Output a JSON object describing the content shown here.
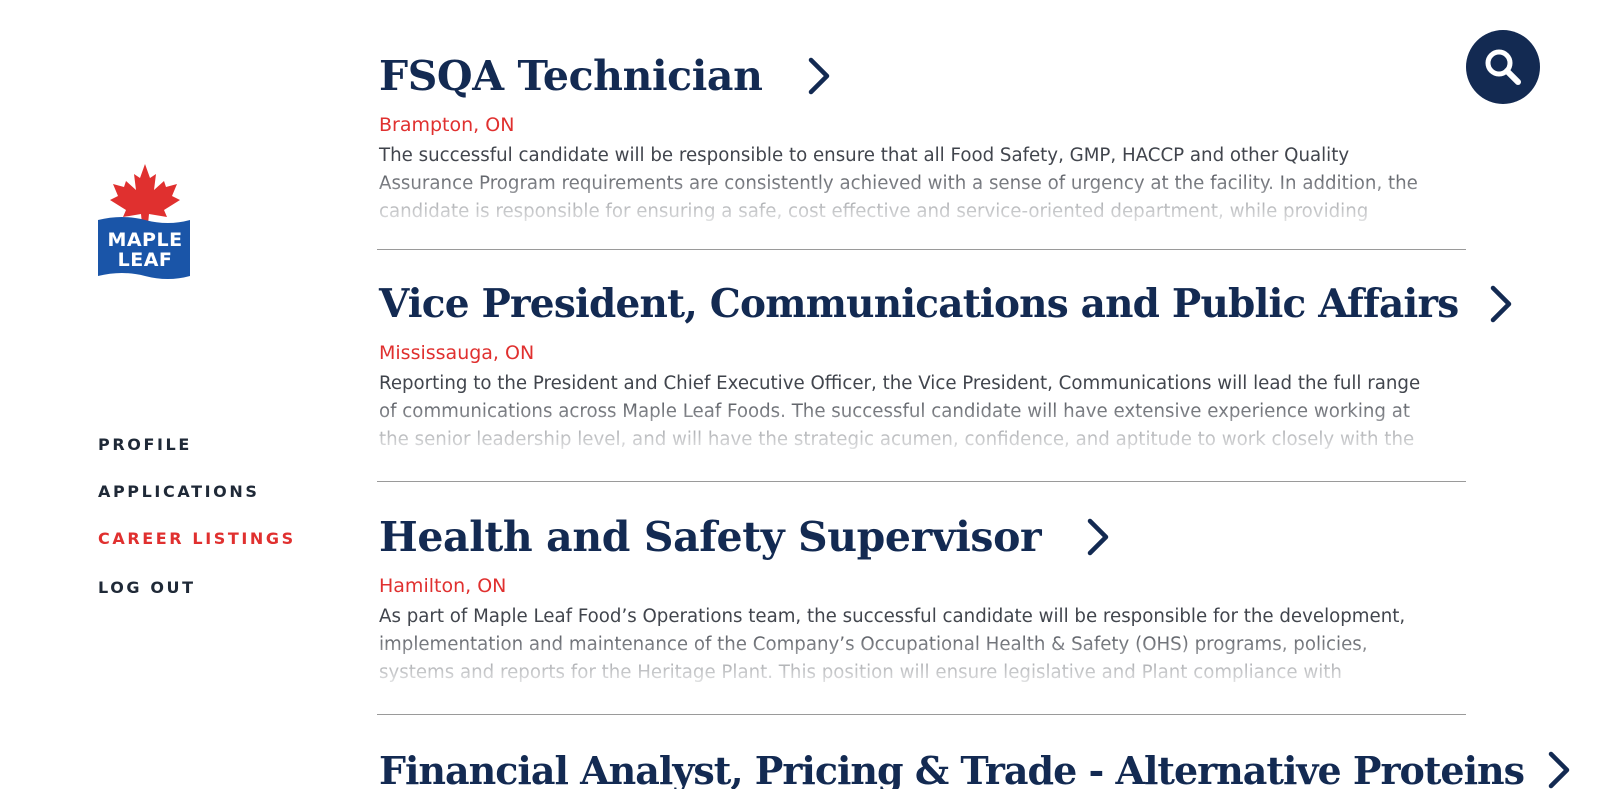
{
  "brand": {
    "logo_line1": "MAPLE",
    "logo_line2": "LEAF",
    "primary_color": "#132a52",
    "accent_color": "#e0302f",
    "logo_blue": "#1a55a8"
  },
  "sidebar": {
    "items": [
      {
        "label": "PROFILE",
        "active": false
      },
      {
        "label": "APPLICATIONS",
        "active": false
      },
      {
        "label": "CAREER LISTINGS",
        "active": true
      },
      {
        "label": "LOG OUT",
        "active": false
      }
    ]
  },
  "search": {
    "icon": "search-icon"
  },
  "jobs": [
    {
      "title": "FSQA Technician",
      "location": "Brampton, ON",
      "description": "The successful candidate will be responsible to ensure that all Food Safety, GMP, HACCP and other Quality Assurance Program requirements are consistently achieved with a sense of urgency at the facility.  In addition, the candidate is responsible for ensuring a safe, cost effective and service-oriented department, while providing"
    },
    {
      "title": "Vice President, Communications and Public Affairs",
      "location": "Mississauga, ON",
      "description": "Reporting to the President and Chief Executive Officer, the Vice President, Communications will lead the full range of communications across Maple Leaf Foods. The successful candidate will have extensive experience working at the senior leadership level, and will have the strategic acumen, confidence, and aptitude to work closely with the CEO,"
    },
    {
      "title": "Health and Safety Supervisor",
      "location": "Hamilton, ON",
      "description": "As part of Maple Leaf Food’s Operations team, the successful candidate will be responsible for the development, implementation and maintenance of the Company’s Occupational Health & Safety (OHS) programs, policies, systems and reports for the Heritage Plant. This position will ensure legislative and Plant compliance with occupational health"
    },
    {
      "title": "Financial Analyst, Pricing & Trade - Alternative Proteins",
      "location": "",
      "description": ""
    }
  ]
}
